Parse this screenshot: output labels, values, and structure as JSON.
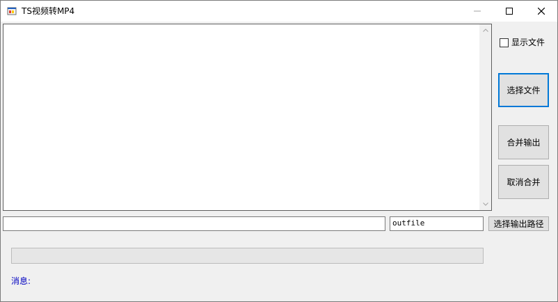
{
  "window": {
    "title": "TS视频转MP4",
    "icon": "windows-form-icon"
  },
  "controls": {
    "minimize_icon": "minimize-icon",
    "maximize_icon": "maximize-icon",
    "close_icon": "close-icon"
  },
  "file_list": {
    "items": []
  },
  "show_files": {
    "label": "显示文件",
    "checked": false
  },
  "buttons": {
    "select_file": "选择文件",
    "merge_output": "合并输出",
    "cancel_merge": "取消合并",
    "select_output_path": "选择输出路径"
  },
  "inputs": {
    "file_path_value": "",
    "output_name_value": "outfile"
  },
  "progress": {
    "value": 0
  },
  "status": {
    "message_label": "消息:"
  },
  "colors": {
    "accent": "#0078d7",
    "message_text": "#0000c0"
  }
}
